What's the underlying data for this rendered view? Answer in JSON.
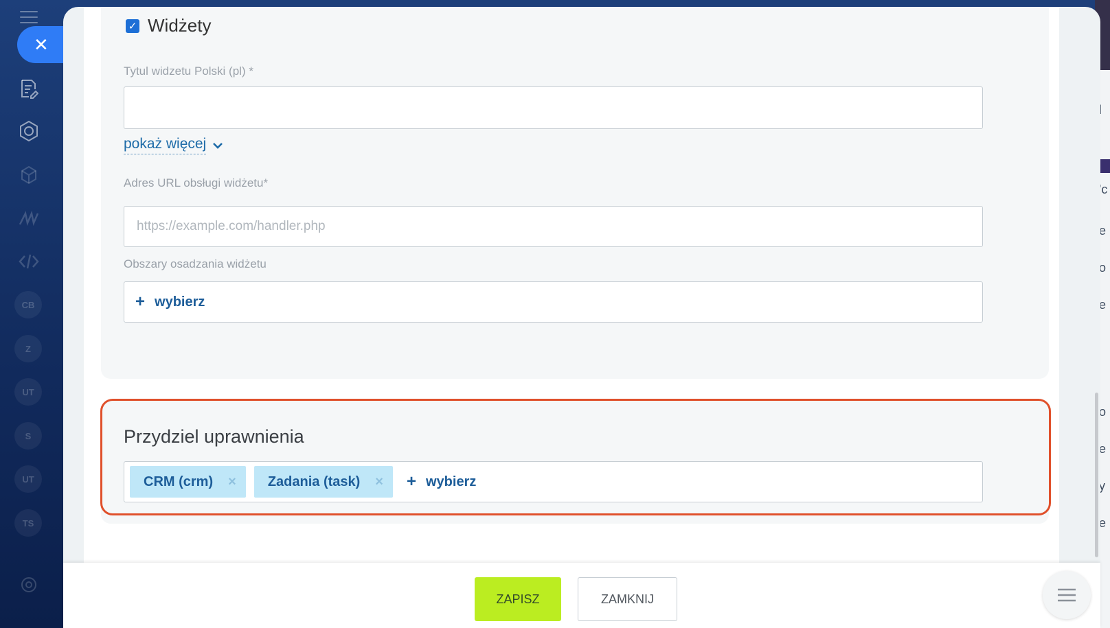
{
  "app_sidebar": {
    "bubbles": [
      "CB",
      "Z",
      "UT",
      "S",
      "UT",
      "TS"
    ]
  },
  "right_strip": {
    "fragments": [
      "l",
      "'c",
      "e",
      "o",
      "e",
      "o",
      "e",
      "y",
      "e"
    ]
  },
  "widgets_section": {
    "checkbox_label": "Widżety",
    "checked": true,
    "title_field": {
      "label": "Tytul widzetu Polski (pl) *",
      "value": ""
    },
    "show_more_label": "pokaż więcej",
    "handler_url_field": {
      "label": "Adres URL obsługi widżetu*",
      "placeholder": "https://example.com/handler.php"
    },
    "placement_field": {
      "label": "Obszary osadzania widżetu",
      "add_label": "wybierz"
    }
  },
  "permissions_section": {
    "title": "Przydziel uprawnienia",
    "tags": [
      {
        "label": "CRM (crm)"
      },
      {
        "label": "Zadania (task)"
      }
    ],
    "add_label": "wybierz",
    "highlight_color": "#e0502b"
  },
  "footer": {
    "save_label": "ZAPISZ",
    "close_label": "ZAMKNIJ",
    "save_color": "#bbed21"
  },
  "colors": {
    "accent_blue": "#2f7cf6",
    "link_blue": "#1d5d99",
    "tag_bg": "#bfe7f8"
  }
}
